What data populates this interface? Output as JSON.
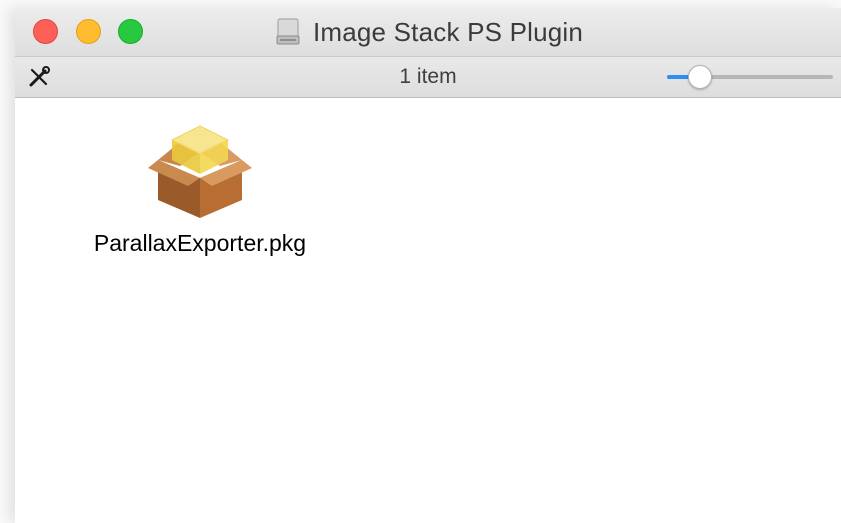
{
  "window": {
    "title": "Image Stack PS Plugin",
    "title_icon": "disk-image-icon",
    "traffic_lights": {
      "close": "#fe5f57",
      "minimize": "#febc2e",
      "zoom": "#28c840"
    }
  },
  "toolbar": {
    "tools_icon": "tools-icon",
    "status": "1 item",
    "icon_size_slider": {
      "value_fraction": 0.15,
      "accent": "#2f8ef2"
    }
  },
  "files": [
    {
      "name": "ParallaxExporter.pkg",
      "icon": "package-icon"
    }
  ]
}
